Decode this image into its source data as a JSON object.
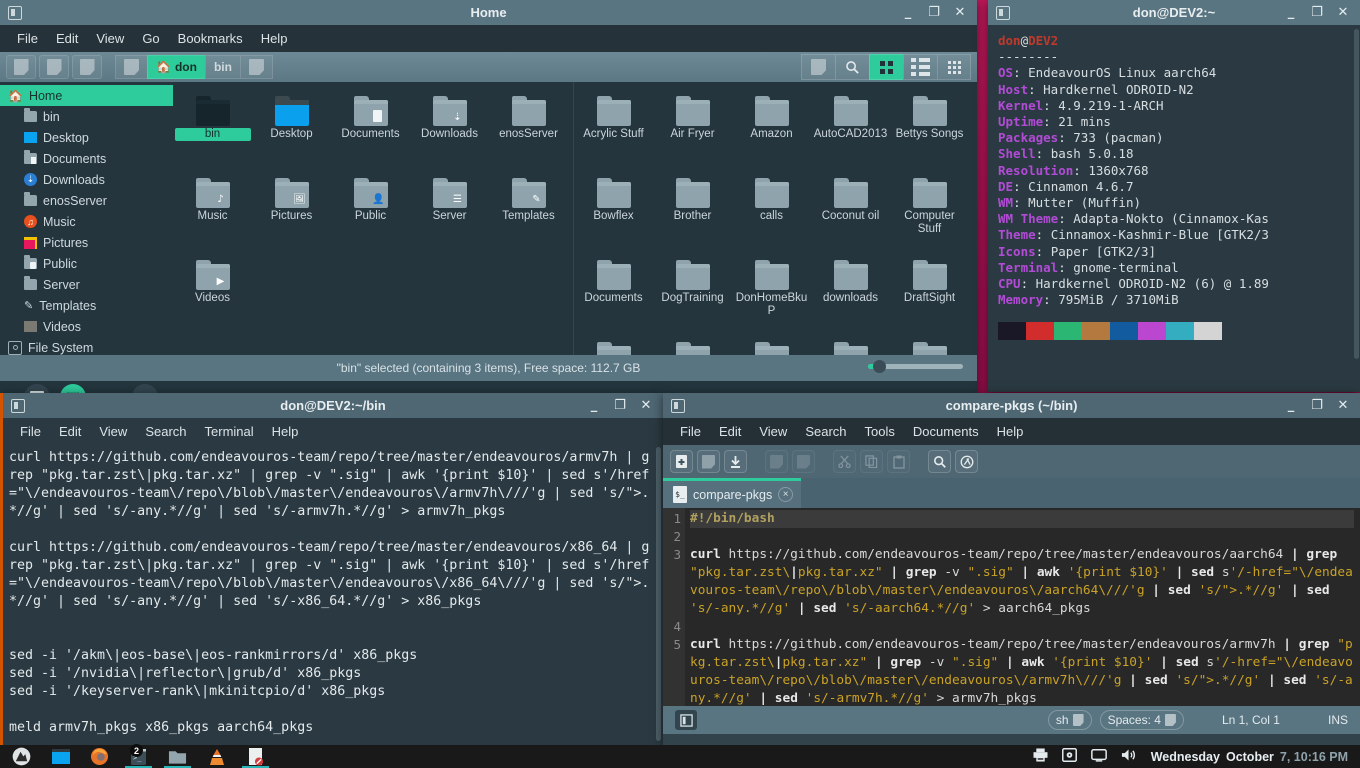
{
  "desktop": {
    "wallpaper_color": "#a01050"
  },
  "file_manager": {
    "title": "Home",
    "menu": [
      "File",
      "Edit",
      "View",
      "Go",
      "Bookmarks",
      "Help"
    ],
    "breadcrumbs": [
      {
        "label": "",
        "active": false
      },
      {
        "label": "don",
        "active": true,
        "icon": "home-icon"
      },
      {
        "label": "bin",
        "active": false
      },
      {
        "label": "",
        "active": false
      }
    ],
    "view_buttons": [
      "icon-view",
      "list-view",
      "compact-view"
    ],
    "selected_view": "icon-view",
    "sidebar": [
      {
        "label": "Home",
        "icon": "home-icon",
        "active": true
      },
      {
        "label": "bin",
        "icon": "folder-icon"
      },
      {
        "label": "Desktop",
        "icon": "desktop-icon"
      },
      {
        "label": "Documents",
        "icon": "documents-icon"
      },
      {
        "label": "Downloads",
        "icon": "downloads-icon"
      },
      {
        "label": "enosServer",
        "icon": "folder-icon"
      },
      {
        "label": "Music",
        "icon": "music-icon"
      },
      {
        "label": "Pictures",
        "icon": "pictures-icon"
      },
      {
        "label": "Public",
        "icon": "public-icon"
      },
      {
        "label": "Server",
        "icon": "folder-icon"
      },
      {
        "label": "Templates",
        "icon": "templates-icon"
      },
      {
        "label": "Videos",
        "icon": "videos-icon"
      },
      {
        "label": "File System",
        "icon": "disk-icon"
      }
    ],
    "files_left": [
      {
        "name": "bin",
        "type": "folder-dark",
        "selected": true
      },
      {
        "name": "Desktop",
        "type": "folder-blue"
      },
      {
        "name": "Documents",
        "type": "folder",
        "emblem": "document"
      },
      {
        "name": "Downloads",
        "type": "folder",
        "emblem": "download"
      },
      {
        "name": "enosServer",
        "type": "folder"
      },
      {
        "name": "Music",
        "type": "folder",
        "emblem": "music"
      },
      {
        "name": "Pictures",
        "type": "folder",
        "emblem": "image"
      },
      {
        "name": "Public",
        "type": "folder",
        "emblem": "person"
      },
      {
        "name": "Server",
        "type": "folder",
        "emblem": "server"
      },
      {
        "name": "Templates",
        "type": "folder",
        "emblem": "template"
      },
      {
        "name": "Videos",
        "type": "folder",
        "emblem": "video"
      }
    ],
    "files_right": [
      {
        "name": "Acrylic Stuff"
      },
      {
        "name": "Air Fryer"
      },
      {
        "name": "Amazon"
      },
      {
        "name": "AutoCAD2013"
      },
      {
        "name": "Bettys Songs"
      },
      {
        "name": "Bowflex"
      },
      {
        "name": "Brother"
      },
      {
        "name": "calls"
      },
      {
        "name": "Coconut oil"
      },
      {
        "name": "Computer Stuff"
      },
      {
        "name": "Documents"
      },
      {
        "name": "DogTraining"
      },
      {
        "name": "DonHomeBkuP"
      },
      {
        "name": "downloads"
      },
      {
        "name": "DraftSight"
      },
      {
        "name": ""
      },
      {
        "name": ""
      },
      {
        "name": ""
      },
      {
        "name": ""
      },
      {
        "name": ""
      }
    ],
    "status": "\"bin\" selected (containing 3 items), Free space: 112.7 GB",
    "zoom_level": 25
  },
  "terminal_neofetch": {
    "title": "don@DEV2:~",
    "user": "don",
    "host": "DEV2",
    "separator": "--------",
    "info": [
      {
        "key": "OS",
        "value": "EndeavourOS Linux aarch64"
      },
      {
        "key": "Host",
        "value": "Hardkernel ODROID-N2"
      },
      {
        "key": "Kernel",
        "value": "4.9.219-1-ARCH"
      },
      {
        "key": "Uptime",
        "value": "21 mins"
      },
      {
        "key": "Packages",
        "value": "733 (pacman)"
      },
      {
        "key": "Shell",
        "value": "bash 5.0.18"
      },
      {
        "key": "Resolution",
        "value": "1360x768"
      },
      {
        "key": "DE",
        "value": "Cinnamon 4.6.7"
      },
      {
        "key": "WM",
        "value": "Mutter (Muffin)"
      },
      {
        "key": "WM Theme",
        "value": "Adapta-Nokto (Cinnamox-Kas"
      },
      {
        "key": "Theme",
        "value": "Cinnamox-Kashmir-Blue [GTK2/3"
      },
      {
        "key": "Icons",
        "value": "Paper [GTK2/3]"
      },
      {
        "key": "Terminal",
        "value": "gnome-terminal"
      },
      {
        "key": "CPU",
        "value": "Hardkernel ODROID-N2 (6) @ 1.89"
      },
      {
        "key": "Memory",
        "value": "795MiB / 3710MiB"
      }
    ],
    "swatches": [
      "#1a1726",
      "#d22d2d",
      "#2cb673",
      "#b3793f",
      "#115b9e",
      "#bb46cf",
      "#34adc0",
      "#d4d4d4"
    ]
  },
  "terminal_bin": {
    "title": "don@DEV2:~/bin",
    "menu": [
      "File",
      "Edit",
      "View",
      "Search",
      "Terminal",
      "Help"
    ],
    "content": "curl https://github.com/endeavouros-team/repo/tree/master/endeavouros/armv7h | grep \"pkg.tar.zst\\|pkg.tar.xz\" | grep -v \".sig\" | awk '{print $10}' | sed s'/href=\"\\/endeavouros-team\\/repo\\/blob\\/master\\/endeavouros\\/armv7h\\///'g | sed 's/\">.*//g' | sed 's/-any.*//g' | sed 's/-armv7h.*//g' > armv7h_pkgs\n\ncurl https://github.com/endeavouros-team/repo/tree/master/endeavouros/x86_64 | grep \"pkg.tar.zst\\|pkg.tar.xz\" | grep -v \".sig\" | awk '{print $10}' | sed s'/href=\"\\/endeavouros-team\\/repo\\/blob\\/master\\/endeavouros\\/x86_64\\///'g | sed 's/\">.*//g' | sed 's/-any.*//g' | sed 's/-x86_64.*//g' > x86_pkgs\n\n\nsed -i '/akm\\|eos-base\\|eos-rankmirrors/d' x86_pkgs\nsed -i '/nvidia\\|reflector\\|grub/d' x86_pkgs\nsed -i '/keyserver-rank\\|mkinitcpio/d' x86_pkgs\n\nmeld armv7h_pkgs x86_pkgs aarch64_pkgs"
  },
  "editor": {
    "title": "compare-pkgs (~/bin)",
    "menu": [
      "File",
      "Edit",
      "View",
      "Search",
      "Tools",
      "Documents",
      "Help"
    ],
    "toolbar_icons": [
      "new-file-icon",
      "open-file-icon",
      "save-icon",
      "undo-icon",
      "redo-icon",
      "cut-icon",
      "copy-icon",
      "paste-icon",
      "find-icon",
      "replace-icon"
    ],
    "tab": {
      "label": "compare-pkgs",
      "icon": "script-file-icon",
      "close": "×"
    },
    "lines": [
      {
        "n": "1",
        "text": "#!/bin/bash",
        "type": "comment",
        "current": true
      },
      {
        "n": "2",
        "text": "",
        "type": "plain"
      },
      {
        "n": "3",
        "text": "curl https://github.com/endeavouros-team/repo/tree/master/endeavouros/aarch64 | grep \"pkg.tar.zst\\|pkg.tar.xz\" | grep -v \".sig\" | awk '{print $10}' | sed s'/-href=\"\\/endeavouros-team\\/repo\\/blob\\/master\\/endeavouros\\/aarch64\\///'g | sed 's/\">.*//g' | sed 's/-any.*//g' | sed 's/-aarch64.*//g' > aarch64_pkgs",
        "type": "code"
      },
      {
        "n": "4",
        "text": "",
        "type": "plain"
      },
      {
        "n": "5",
        "text": "curl https://github.com/endeavouros-team/repo/tree/master/endeavouros/armv7h | grep \"pkg.tar.zst\\|pkg.tar.xz\" | grep -v \".sig\" | awk '{print $10}' | sed s'/-href=\"\\/endeavouros-team\\/repo\\/blob\\/master\\/endeavouros\\/armv7h\\///'g | sed 's/\">.*//g' | sed 's/-any.*//g' | sed 's/-armv7h.*//g' > armv7h_pkgs",
        "type": "code"
      }
    ],
    "status": {
      "language": "sh",
      "indent": "Spaces: 4",
      "position": "Ln 1, Col 1",
      "mode": "INS"
    }
  },
  "taskbar": {
    "launchers": [
      {
        "name": "menu-icon"
      },
      {
        "name": "show-desktop-icon"
      },
      {
        "name": "firefox-icon"
      },
      {
        "name": "terminal-icon",
        "badge": "2"
      },
      {
        "name": "files-icon"
      },
      {
        "name": "vlc-icon"
      },
      {
        "name": "text-editor-icon"
      }
    ],
    "tray": [
      "printer-icon",
      "disk-icon",
      "display-icon",
      "volume-icon"
    ],
    "clock_day": "Wednesday",
    "clock_month": "October",
    "clock_rest": "7, 10:16 PM"
  }
}
